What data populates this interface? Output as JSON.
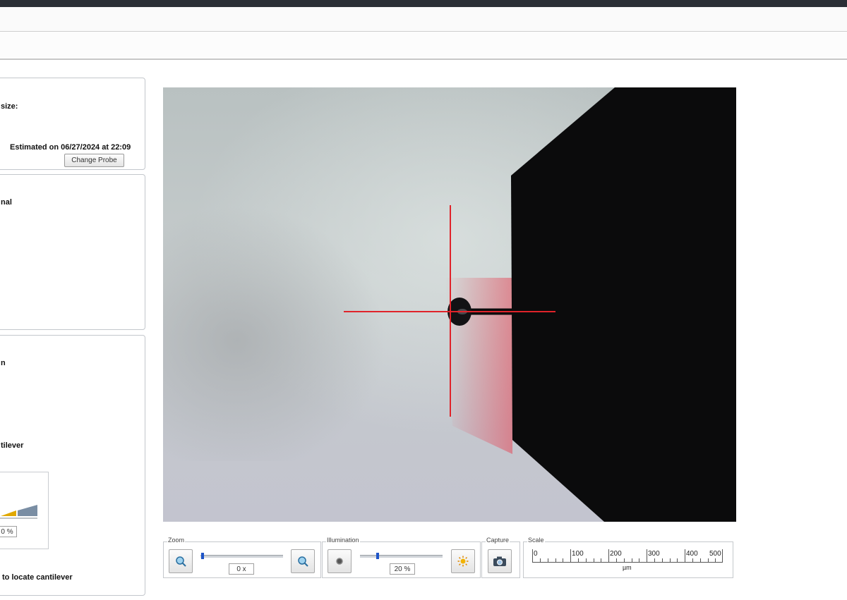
{
  "probe_panel": {
    "size_label": "size:",
    "estimate_text": "Estimated on 06/27/2024 at 22:09",
    "change_probe_button": "Change Probe"
  },
  "signal_panel": {
    "label": "nal"
  },
  "align_panel": {
    "label_top": "n",
    "cantilever_label": "tilever",
    "percent_value": "0 %",
    "locate_text": "to locate cantilever"
  },
  "video": {
    "reticle_color": "#e0232a"
  },
  "zoom": {
    "label": "Zoom",
    "value": "0 x",
    "slider_fraction": 0.0
  },
  "illumination": {
    "label": "Illumination",
    "value": "20 %",
    "slider_fraction": 0.2
  },
  "capture": {
    "label": "Capture"
  },
  "scale": {
    "label": "Scale",
    "unit": "µm",
    "ticks": [
      "0",
      "100",
      "200",
      "300",
      "400",
      "500"
    ]
  }
}
